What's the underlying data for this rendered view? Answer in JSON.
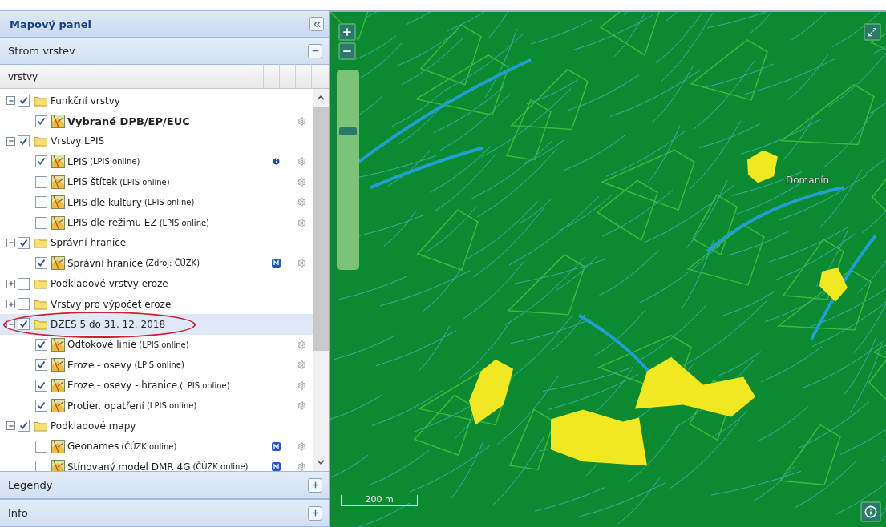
{
  "panel": {
    "title": "Mapový panel"
  },
  "accordion": [
    {
      "title": "Strom vrstev",
      "expanded": true
    },
    {
      "title": "Legendy",
      "expanded": false
    },
    {
      "title": "Info",
      "expanded": false
    }
  ],
  "tree": {
    "column": "vrstvy",
    "items": [
      {
        "kind": "folder",
        "label": "Funkční vrstvy",
        "checked": true,
        "expanded": true,
        "selected": false,
        "circled": false,
        "children": [
          {
            "kind": "layer",
            "label": "Vybrané DPB/EP/EUC",
            "checked": true,
            "selected": false,
            "bold": true,
            "info_badge": false,
            "metadata_badge": false
          }
        ]
      },
      {
        "kind": "folder",
        "label": "Vrstvy LPIS",
        "checked": true,
        "expanded": true,
        "selected": false,
        "circled": false,
        "children": [
          {
            "kind": "layer",
            "label": "LPIS",
            "source": "(LPIS online)",
            "checked": true,
            "selected": false,
            "bold": false,
            "info_badge": true,
            "metadata_badge": false
          },
          {
            "kind": "layer",
            "label": "LPIS štítek",
            "source": "(LPIS online)",
            "checked": false,
            "selected": false,
            "bold": false,
            "info_badge": false,
            "metadata_badge": false
          },
          {
            "kind": "layer",
            "label": "LPIS dle kultury",
            "source": "(LPIS online)",
            "checked": false,
            "selected": false,
            "bold": false,
            "info_badge": false,
            "metadata_badge": false
          },
          {
            "kind": "layer",
            "label": "LPIS dle režimu EZ",
            "source": "(LPIS online)",
            "checked": false,
            "selected": false,
            "bold": false,
            "info_badge": false,
            "metadata_badge": false
          }
        ]
      },
      {
        "kind": "folder",
        "label": "Správní hranice",
        "checked": true,
        "expanded": true,
        "selected": false,
        "circled": false,
        "children": [
          {
            "kind": "layer",
            "label": "Správní hranice",
            "source": "(Zdroj: ČÚZK)",
            "checked": true,
            "selected": false,
            "bold": false,
            "info_badge": false,
            "metadata_badge": true
          }
        ]
      },
      {
        "kind": "folder",
        "label": "Podkladové vrstvy eroze",
        "checked": false,
        "expanded": false,
        "selected": false,
        "circled": false
      },
      {
        "kind": "folder",
        "label": "Vrstvy pro výpočet eroze",
        "checked": false,
        "expanded": false,
        "selected": false,
        "circled": false
      },
      {
        "kind": "folder",
        "label": "DZES 5 do 31. 12. 2018",
        "checked": true,
        "expanded": true,
        "selected": true,
        "circled": true,
        "children": [
          {
            "kind": "layer",
            "label": "Odtokové linie",
            "source": "(LPIS online)",
            "checked": true,
            "selected": false,
            "bold": false,
            "info_badge": false,
            "metadata_badge": false
          },
          {
            "kind": "layer",
            "label": "Eroze - osevy",
            "source": "(LPIS online)",
            "checked": true,
            "selected": false,
            "bold": false,
            "info_badge": false,
            "metadata_badge": false
          },
          {
            "kind": "layer",
            "label": "Eroze - osevy - hranice",
            "source": "(LPIS online)",
            "checked": true,
            "selected": false,
            "bold": false,
            "info_badge": false,
            "metadata_badge": false
          },
          {
            "kind": "layer",
            "label": "Protier. opatření",
            "source": "(LPIS online)",
            "checked": true,
            "selected": false,
            "bold": false,
            "info_badge": false,
            "metadata_badge": false
          }
        ]
      },
      {
        "kind": "folder",
        "label": "Podkladové mapy",
        "checked": true,
        "expanded": true,
        "selected": false,
        "circled": false,
        "children": [
          {
            "kind": "layer",
            "label": "Geonames",
            "source": "(ČÚZK online)",
            "checked": false,
            "selected": false,
            "bold": false,
            "info_badge": false,
            "metadata_badge": true
          },
          {
            "kind": "layer",
            "label": "Stínovaný model DMR 4G",
            "source": "(ČÚZK online)",
            "checked": false,
            "selected": false,
            "bold": false,
            "info_badge": false,
            "metadata_badge": true
          }
        ]
      }
    ]
  },
  "map": {
    "zoom_slider": {
      "level": 0.7
    },
    "place_label": "Domanín",
    "scale": "200 m"
  }
}
